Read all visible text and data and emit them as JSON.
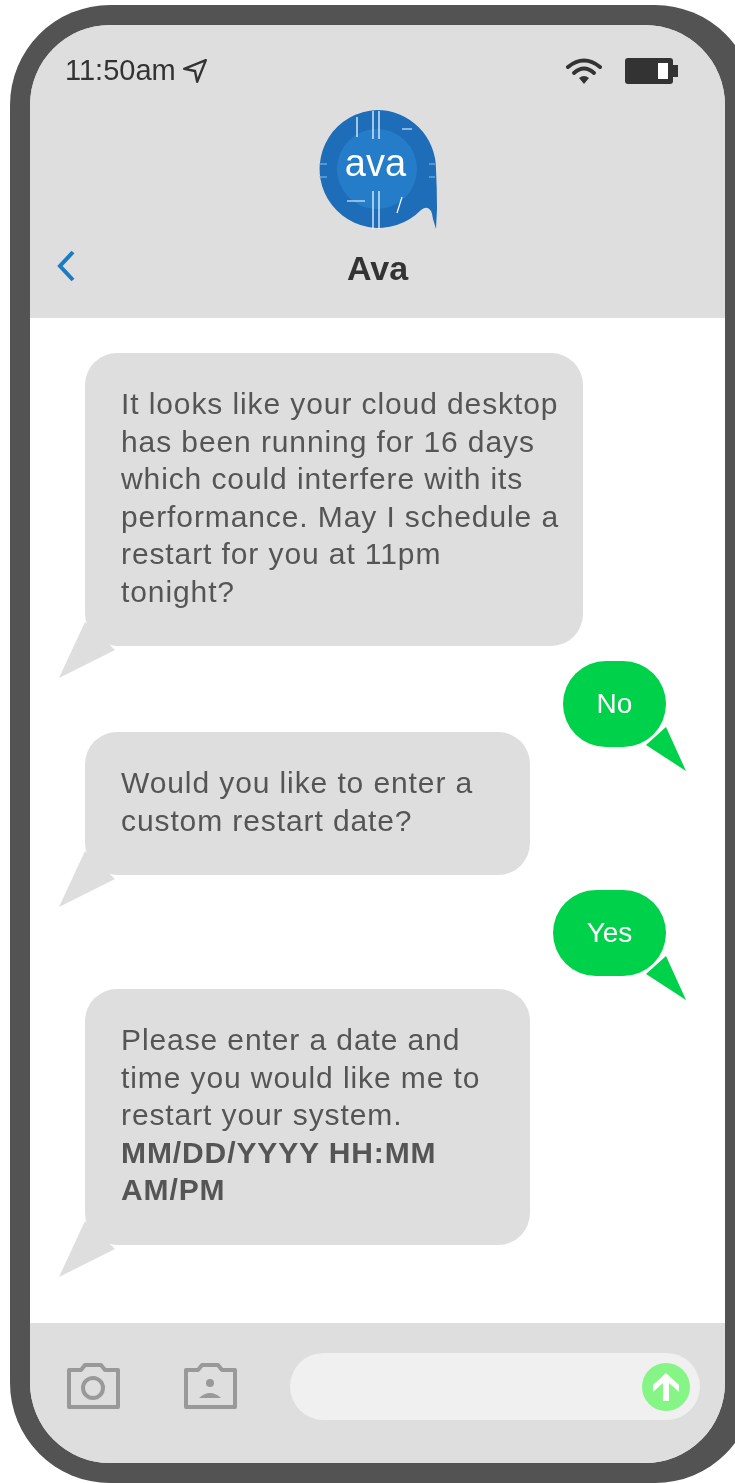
{
  "status_bar": {
    "time": "11:50am"
  },
  "header": {
    "logo_text": "ava",
    "contact_name": "Ava"
  },
  "messages": [
    {
      "kind": "incoming",
      "text": "It looks like your cloud desktop has been running for 16 days which could interfere with its performance. May I schedule a restart for you at 11pm tonight?"
    },
    {
      "kind": "outgoing",
      "text": "No"
    },
    {
      "kind": "incoming",
      "text": "Would you like to enter a custom restart date?"
    },
    {
      "kind": "outgoing",
      "text": "Yes"
    },
    {
      "kind": "incoming",
      "text": "Please enter a date and time you would like me to restart your system. **MM/DD/YYYY HH:MM AM/PM**"
    }
  ]
}
